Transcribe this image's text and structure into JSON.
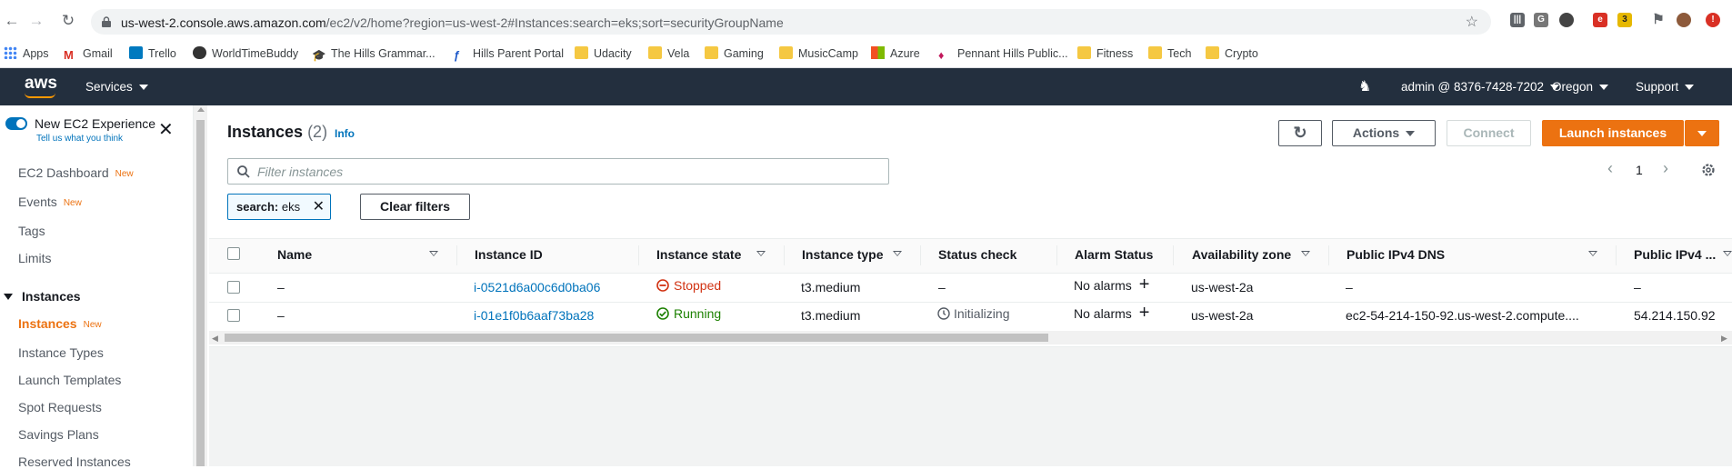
{
  "browser": {
    "url_host": "us-west-2.console.aws.amazon.com",
    "url_path": "/ec2/v2/home?region=us-west-2#Instances:search=eks;sort=securityGroupName",
    "bookmarks": [
      "Apps",
      "Gmail",
      "Trello",
      "WorldTimeBuddy",
      "The Hills Grammar...",
      "Hills Parent Portal",
      "Udacity",
      "Vela",
      "Gaming",
      "MusicCamp",
      "Azure",
      "Pennant Hills Public...",
      "Fitness",
      "Tech",
      "Crypto"
    ],
    "extension_badge": "3"
  },
  "aws_header": {
    "logo": "aws",
    "services": "Services",
    "account": "admin @ 8376-7428-7202",
    "region": "Oregon",
    "support": "Support"
  },
  "sidebar": {
    "new_experience": "New EC2 Experience",
    "tell_us": "Tell us what you think",
    "new_tag": "New",
    "items": [
      "EC2 Dashboard",
      "Events",
      "Tags",
      "Limits"
    ],
    "section": "Instances",
    "section_items": [
      "Instances",
      "Instance Types",
      "Launch Templates",
      "Spot Requests",
      "Savings Plans",
      "Reserved Instances"
    ]
  },
  "main": {
    "title": "Instances",
    "count": "(2)",
    "info": "Info",
    "actions": "Actions",
    "connect": "Connect",
    "launch": "Launch instances",
    "filter_placeholder": "Filter instances",
    "chip_key": "search:",
    "chip_value": "eks",
    "clear_filters": "Clear filters",
    "page": "1"
  },
  "table": {
    "columns": [
      "Name",
      "Instance ID",
      "Instance state",
      "Instance type",
      "Status check",
      "Alarm Status",
      "Availability zone",
      "Public IPv4 DNS",
      "Public IPv4 ..."
    ],
    "rows": [
      {
        "name": "–",
        "id": "i-0521d6a00c6d0ba06",
        "state": "Stopped",
        "type": "t3.medium",
        "status": "–",
        "alarm": "No alarms",
        "az": "us-west-2a",
        "dns": "–",
        "ip": "–"
      },
      {
        "name": "–",
        "id": "i-01e1f0b6aaf73ba28",
        "state": "Running",
        "type": "t3.medium",
        "status": "Initializing",
        "alarm": "No alarms",
        "az": "us-west-2a",
        "dns": "ec2-54-214-150-92.us-west-2.compute....",
        "ip": "54.214.150.92"
      }
    ]
  },
  "colors": {
    "aws_header": "#232f3e",
    "accent_orange": "#ec7211",
    "link_blue": "#0073bb",
    "stopped_red": "#d13212",
    "running_green": "#1d8102"
  }
}
